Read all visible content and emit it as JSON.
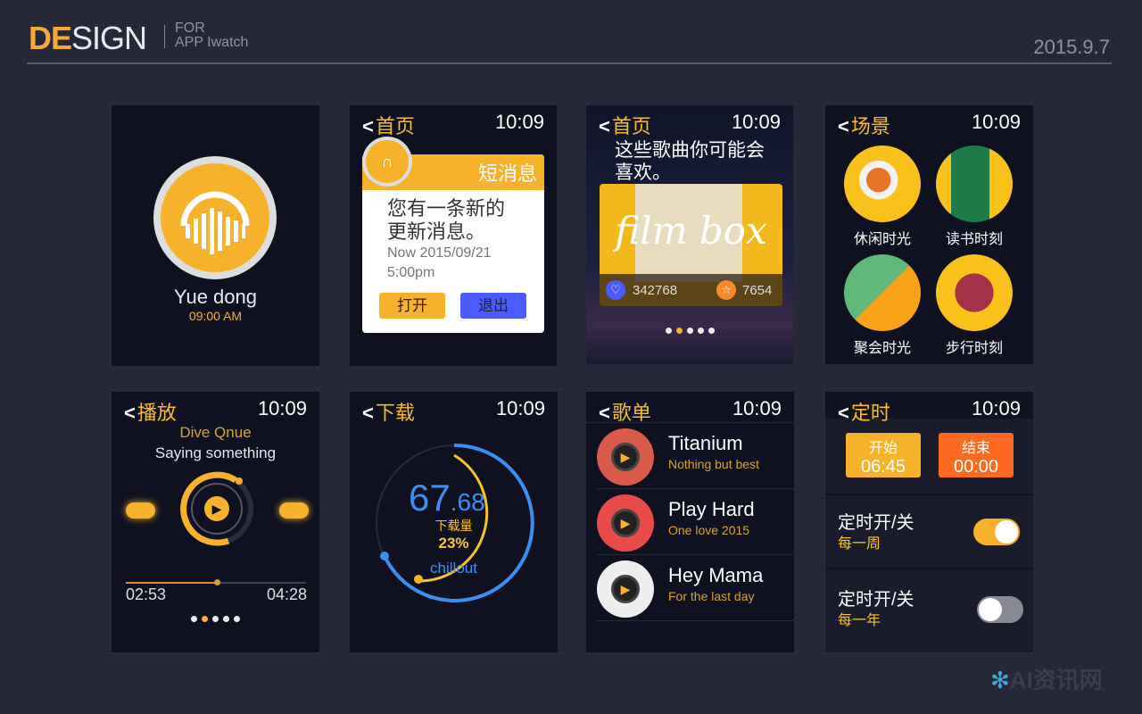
{
  "header": {
    "logo_accent": "DE",
    "logo_rest": "SIGN",
    "for": "FOR",
    "app": "APP Iwatch",
    "date": "2015.9.7"
  },
  "watermark": "AI资讯网",
  "colors": {
    "accent": "#f6b22a",
    "blue": "#3b8ff0",
    "orange": "#fb6a20",
    "purple": "#4b5bff"
  },
  "time": "10:09",
  "back_icon": "chevron-left-icon",
  "screen1": {
    "name": "Yue dong",
    "time": "09:00 AM",
    "icon": "headphones-waveform-icon"
  },
  "screen2": {
    "title": "首页",
    "banner": "短消息",
    "message": "您有一条新的更新消息。",
    "date": "Now 2015/09/21",
    "time": "5:00pm",
    "open": "打开",
    "exit": "退出"
  },
  "screen3": {
    "title": "首页",
    "headline": "这些歌曲你可能会喜欢。",
    "image_text": "film box",
    "likes": "342768",
    "stars": "7654",
    "page": 2,
    "pages": 5
  },
  "screen4": {
    "title": "场景",
    "items": [
      {
        "label": "休闲时光"
      },
      {
        "label": "读书时刻"
      },
      {
        "label": "聚会时光"
      },
      {
        "label": "步行时刻"
      }
    ]
  },
  "screen5": {
    "title": "播放",
    "artist": "Dive Qnue",
    "song": "Saying something",
    "elapsed": "02:53",
    "total": "04:28",
    "progress": 0.49,
    "page": 2,
    "pages": 5
  },
  "screen6": {
    "title": "下载",
    "big": "67",
    "small": ".68",
    "label": "下载量",
    "percent": "23%",
    "name": "chillout"
  },
  "screen7": {
    "title": "歌单",
    "songs": [
      {
        "name": "Titanium",
        "sub": "Nothing but best"
      },
      {
        "name": "Play Hard",
        "sub": "One love 2015"
      },
      {
        "name": "Hey Mama",
        "sub": "For the last day"
      }
    ]
  },
  "screen8": {
    "title": "定时",
    "start_label": "开始",
    "start": "06:45",
    "end_label": "结束",
    "end": "00:00",
    "rows": [
      {
        "label": "定时开/关",
        "sub": "每一周",
        "on": true
      },
      {
        "label": "定时开/关",
        "sub": "每一年",
        "on": false
      }
    ]
  }
}
